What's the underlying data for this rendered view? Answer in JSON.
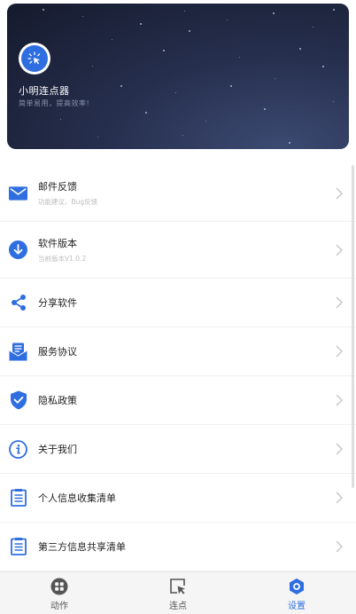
{
  "header": {
    "app_name": "小明连点器",
    "slogan": "简单易用，提高效率!"
  },
  "menu": {
    "items": [
      {
        "label": "邮件反馈",
        "sub": "功能建议、Bug反馈",
        "icon": "mail-icon"
      },
      {
        "label": "软件版本",
        "sub": "当前版本V1.0.2",
        "icon": "download-icon"
      },
      {
        "label": "分享软件",
        "icon": "share-icon"
      },
      {
        "label": "服务协议",
        "icon": "agreement-icon"
      },
      {
        "label": "隐私政策",
        "icon": "shield-icon"
      },
      {
        "label": "关于我们",
        "icon": "info-icon"
      },
      {
        "label": "个人信息收集清单",
        "icon": "list-icon"
      },
      {
        "label": "第三方信息共享清单",
        "icon": "list-icon"
      }
    ]
  },
  "bottom_nav": {
    "items": [
      {
        "label": "动作",
        "icon": "apps-icon",
        "active": false
      },
      {
        "label": "连点",
        "icon": "cursor-click-icon",
        "active": false
      },
      {
        "label": "设置",
        "icon": "settings-icon",
        "active": true
      }
    ]
  },
  "colors": {
    "accent": "#2f6ee0",
    "banner_dark": "#151a2c",
    "text_primary": "#222222",
    "text_secondary": "#bdbdbd"
  }
}
